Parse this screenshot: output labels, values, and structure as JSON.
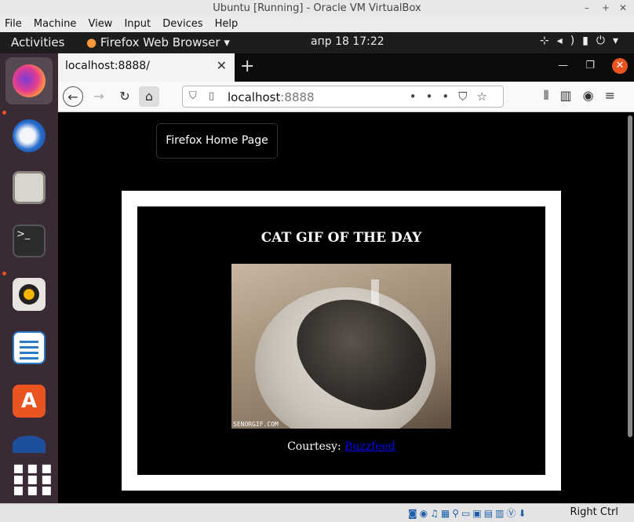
{
  "vbox": {
    "title": "Ubuntu [Running] - Oracle VM VirtualBox",
    "menu": [
      "File",
      "Machine",
      "View",
      "Input",
      "Devices",
      "Help"
    ],
    "host_key": "Right Ctrl"
  },
  "gnome": {
    "activities": "Activities",
    "app_name": "Firefox Web Browser",
    "clock": "апр 18  17:22"
  },
  "dock": {
    "apps": [
      "Firefox",
      "Thunderbird",
      "Files",
      "Terminal",
      "Rhythmbox",
      "LibreOffice Writer",
      "Ubuntu Software",
      "Show Applications"
    ]
  },
  "firefox": {
    "tab_title": "localhost:8888/",
    "url_host": "localhost",
    "url_port": ":8888"
  },
  "page": {
    "home_button": "Firefox Home Page",
    "heading": "CAT GIF OF THE DAY",
    "gif_watermark": "SENORGIF.COM",
    "courtesy_label": "Courtesy:",
    "courtesy_link": "Buzzfeed"
  },
  "colors": {
    "accent": "#e9541e",
    "dock": "#3a2a36",
    "link": "#0000ee"
  }
}
